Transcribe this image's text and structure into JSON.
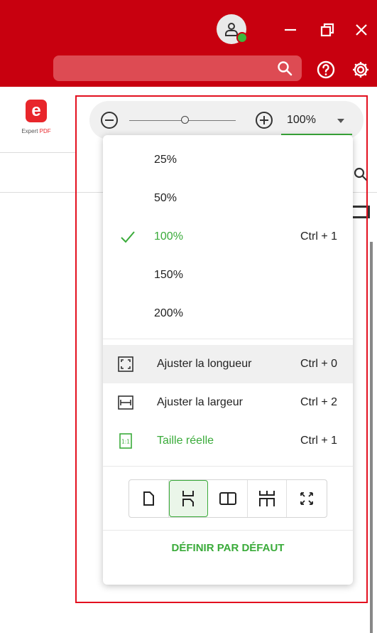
{
  "app": {
    "logo_letter": "e",
    "logo_text_main": "Expert ",
    "logo_text_accent": "PDF"
  },
  "search": {
    "placeholder": ""
  },
  "zoom": {
    "current": "100%",
    "slider_fraction": 0.52,
    "levels": [
      {
        "label": "25%",
        "shortcut": ""
      },
      {
        "label": "50%",
        "shortcut": ""
      },
      {
        "label": "100%",
        "shortcut": "Ctrl + 1",
        "active": true
      },
      {
        "label": "150%",
        "shortcut": ""
      },
      {
        "label": "200%",
        "shortcut": ""
      }
    ]
  },
  "fit": [
    {
      "label": "Ajuster la longueur",
      "shortcut": "Ctrl + 0",
      "icon": "fit-page-icon"
    },
    {
      "label": "Ajuster la largeur",
      "shortcut": "Ctrl + 2",
      "icon": "fit-width-icon"
    },
    {
      "label": "Taille réelle",
      "shortcut": "Ctrl + 1",
      "icon": "actual-size-icon",
      "icon_text": "1:1"
    }
  ],
  "view_modes": [
    "single-page-icon",
    "continuous-scroll-icon",
    "two-page-icon",
    "two-page-continuous-icon",
    "fullscreen-icon"
  ],
  "default_button": "DÉFINIR PAR DÉFAUT",
  "colors": {
    "titlebar": "#c8000f",
    "accent": "#3aab3a",
    "highlight_outline": "#e3101f",
    "logo": "#e8262b"
  }
}
